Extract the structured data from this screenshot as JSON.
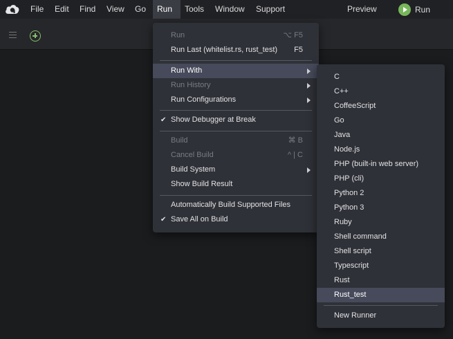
{
  "menubar": {
    "items": [
      "File",
      "Edit",
      "Find",
      "View",
      "Go",
      "Run",
      "Tools",
      "Window",
      "Support"
    ],
    "preview_label": "Preview",
    "run_label": "Run"
  },
  "run_menu": {
    "run": {
      "label": "Run",
      "shortcut": "⌥ F5"
    },
    "run_last": {
      "label": "Run Last (whitelist.rs, rust_test)",
      "shortcut": "F5"
    },
    "run_with": {
      "label": "Run With"
    },
    "run_history": {
      "label": "Run History"
    },
    "run_configurations": {
      "label": "Run Configurations"
    },
    "show_debugger": {
      "label": "Show Debugger at Break"
    },
    "build": {
      "label": "Build",
      "shortcut": "⌘ B"
    },
    "cancel_build": {
      "label": "Cancel Build",
      "shortcut": "^ | C"
    },
    "build_system": {
      "label": "Build System"
    },
    "show_build_result": {
      "label": "Show Build Result"
    },
    "auto_build": {
      "label": "Automatically Build Supported Files"
    },
    "save_all_on_build": {
      "label": "Save All on Build"
    }
  },
  "run_with_menu": {
    "runners": [
      "C",
      "C++",
      "CoffeeScript",
      "Go",
      "Java",
      "Node.js",
      "PHP (built-in web server)",
      "PHP (cli)",
      "Python 2",
      "Python 3",
      "Ruby",
      "Shell command",
      "Shell script",
      "Typescript",
      "Rust",
      "Rust_test"
    ],
    "selected": "Rust_test",
    "new_runner": "New Runner"
  },
  "colors": {
    "accent_green": "#78b65b",
    "menu_bg": "#2f3138",
    "highlight_bg": "#464a5a"
  },
  "icons": [
    "cloud9-logo",
    "hamburger-icon",
    "plus-circle-icon",
    "play-icon",
    "checkmark-icon",
    "submenu-arrow-icon"
  ]
}
